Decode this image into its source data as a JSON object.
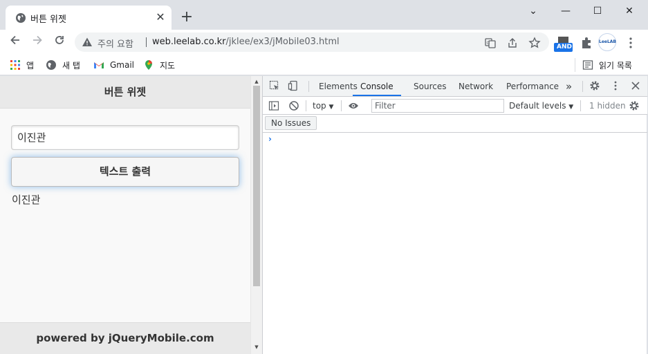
{
  "browser": {
    "tab_title": "버튼 위젯",
    "tab_close": "✕",
    "new_tab": "+",
    "window_controls": {
      "minimize": "—",
      "maximize": "☐",
      "close": "✕",
      "tablist": "⌄"
    },
    "security_label": "주의 요함",
    "url_host": "web.leelab.co.kr",
    "url_path": "/jklee/ex3/jMobile03.html",
    "extension_and_label": "AND",
    "profile_label": "LeeLAB",
    "bookmarks": [
      {
        "label": "앱",
        "icon": "apps-grid-icon"
      },
      {
        "label": "새 탭",
        "icon": "globe-icon"
      },
      {
        "label": "Gmail",
        "icon": "gmail-icon"
      },
      {
        "label": "지도",
        "icon": "maps-pin-icon"
      }
    ],
    "reading_list": "읽기 목록"
  },
  "page": {
    "header_title": "버튼 위젯",
    "input_value": "이진관",
    "button_label": "텍스트 출력",
    "output_text": "이진관",
    "footer_text": "powered by jQueryMobile.com"
  },
  "devtools": {
    "tabs": [
      {
        "label": "Elements",
        "active": false
      },
      {
        "label": "Console",
        "active": true
      },
      {
        "label": "Sources",
        "active": false
      },
      {
        "label": "Network",
        "active": false
      },
      {
        "label": "Performance",
        "active": false
      }
    ],
    "more_tabs": "»",
    "context": "top",
    "filter_placeholder": "Filter",
    "levels": "Default levels",
    "hidden_count": "1 hidden",
    "issues_button": "No Issues",
    "prompt": "›"
  }
}
